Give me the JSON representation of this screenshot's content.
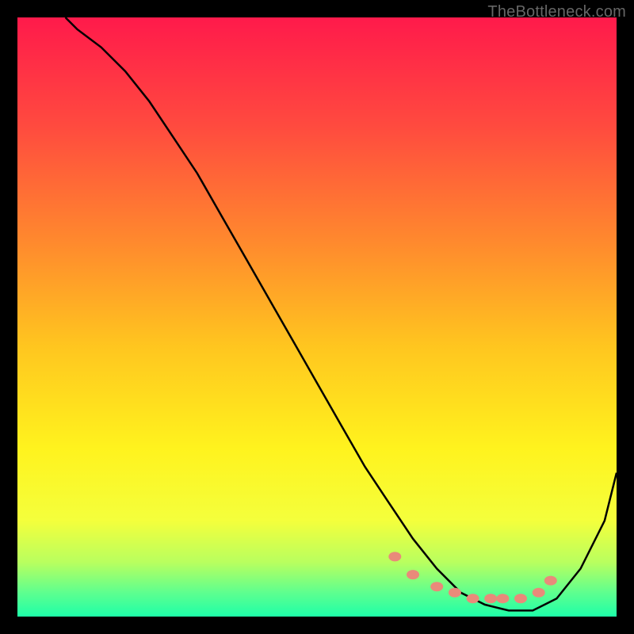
{
  "watermark": "TheBottleneck.com",
  "chart_data": {
    "type": "line",
    "title": "",
    "xlabel": "",
    "ylabel": "",
    "xlim": [
      0,
      100
    ],
    "ylim": [
      0,
      100
    ],
    "grid": false,
    "legend": false,
    "background_gradient": {
      "stops": [
        {
          "offset": 0.0,
          "color": "#ff1a4b"
        },
        {
          "offset": 0.18,
          "color": "#ff4a3f"
        },
        {
          "offset": 0.38,
          "color": "#ff8b2d"
        },
        {
          "offset": 0.55,
          "color": "#ffc61f"
        },
        {
          "offset": 0.72,
          "color": "#fff31e"
        },
        {
          "offset": 0.84,
          "color": "#f4ff3c"
        },
        {
          "offset": 0.91,
          "color": "#b8ff5f"
        },
        {
          "offset": 0.96,
          "color": "#5eff8f"
        },
        {
          "offset": 1.0,
          "color": "#1effa8"
        }
      ]
    },
    "series": [
      {
        "name": "curve",
        "stroke": "#000000",
        "x": [
          8,
          10,
          14,
          18,
          22,
          26,
          30,
          34,
          38,
          42,
          46,
          50,
          54,
          58,
          62,
          66,
          70,
          74,
          78,
          82,
          86,
          90,
          94,
          98,
          100
        ],
        "y": [
          100,
          98,
          95,
          91,
          86,
          80,
          74,
          67,
          60,
          53,
          46,
          39,
          32,
          25,
          19,
          13,
          8,
          4,
          2,
          1,
          1,
          3,
          8,
          16,
          24
        ]
      }
    ],
    "markers": {
      "name": "highlight-dots",
      "color": "#e98a7a",
      "x": [
        63,
        66,
        70,
        73,
        76,
        79,
        81,
        84,
        87,
        89
      ],
      "y": [
        10,
        7,
        5,
        4,
        3,
        3,
        3,
        3,
        4,
        6
      ]
    }
  }
}
